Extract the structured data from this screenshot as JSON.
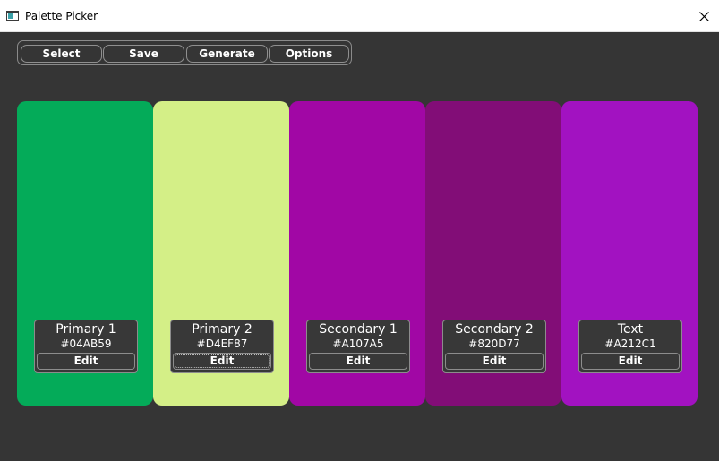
{
  "window": {
    "title": "Palette Picker",
    "icon": "app-window-icon",
    "close_icon": "close-icon"
  },
  "toolbar": {
    "select_label": "Select",
    "save_label": "Save",
    "generate_label": "Generate",
    "options_label": "Options"
  },
  "palette": {
    "colors": [
      {
        "name": "Primary 1",
        "hex": "#04AB59",
        "edit_label": "Edit",
        "focused": false
      },
      {
        "name": "Primary 2",
        "hex": "#D4EF87",
        "edit_label": "Edit",
        "focused": true
      },
      {
        "name": "Secondary 1",
        "hex": "#A107A5",
        "edit_label": "Edit",
        "focused": false
      },
      {
        "name": "Secondary 2",
        "hex": "#820D77",
        "edit_label": "Edit",
        "focused": false
      },
      {
        "name": "Text",
        "hex": "#A212C1",
        "edit_label": "Edit",
        "focused": false
      }
    ]
  },
  "theme": {
    "background": "#353535",
    "panel": "#383838",
    "border": "#8c8c8c",
    "text": "#ffffff"
  }
}
